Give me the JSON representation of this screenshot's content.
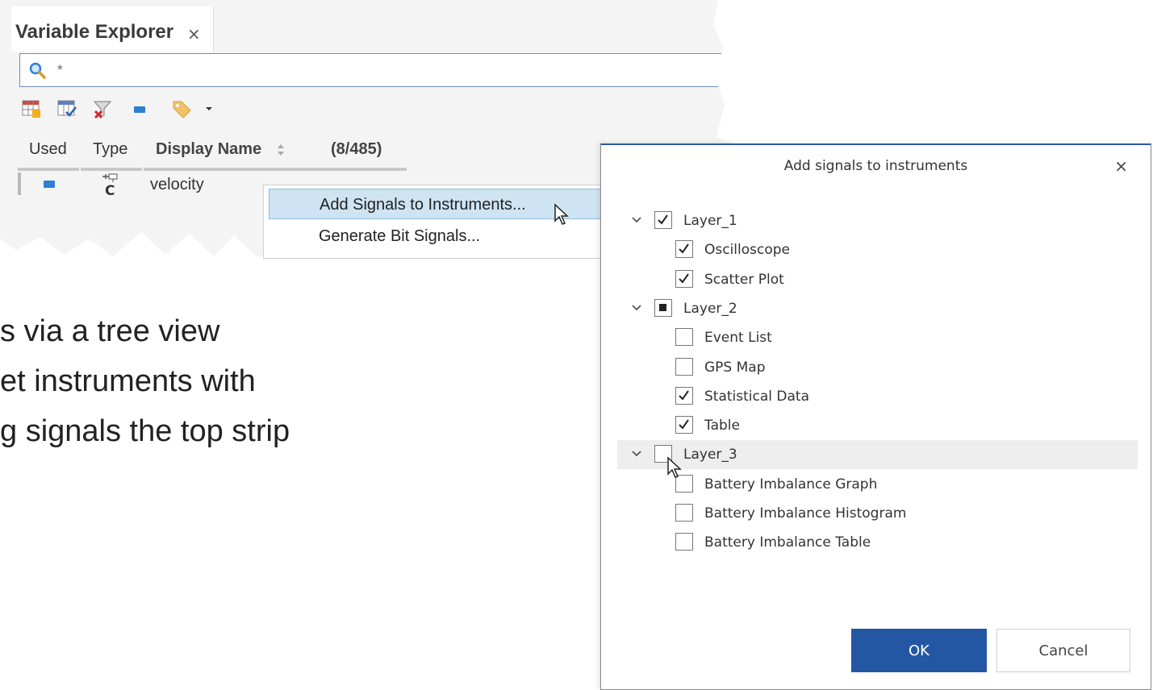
{
  "explorer": {
    "tab_title": "Variable Explorer",
    "tab_close": "×",
    "search_value": "*",
    "columns": {
      "used": "Used",
      "type": "Type",
      "display_name": "Display Name",
      "count": "(8/485)"
    },
    "row": {
      "name": "velocity",
      "type_glyph": "C"
    },
    "toolbar_icons": [
      "table-add-icon",
      "table-check-icon",
      "filter-clear-icon",
      "signal-icon",
      "tag-icon",
      "dropdown-arrow-icon"
    ]
  },
  "context_menu": {
    "items": [
      {
        "label": "Add Signals to Instruments..."
      },
      {
        "label": "Generate Bit Signals..."
      }
    ]
  },
  "background_text": {
    "line1": "s via a tree view",
    "line2": "et instruments with",
    "line3": "g signals the top strip"
  },
  "dialog": {
    "title": "Add signals to instruments",
    "close": "×",
    "tree": [
      {
        "label": "Layer_1",
        "level": 0,
        "state": "checked"
      },
      {
        "label": "Oscilloscope",
        "level": 1,
        "state": "checked"
      },
      {
        "label": "Scatter Plot",
        "level": 1,
        "state": "checked"
      },
      {
        "label": "Layer_2",
        "level": 0,
        "state": "indeterminate"
      },
      {
        "label": "Event List",
        "level": 1,
        "state": "unchecked"
      },
      {
        "label": "GPS Map",
        "level": 1,
        "state": "unchecked"
      },
      {
        "label": "Statistical Data",
        "level": 1,
        "state": "checked"
      },
      {
        "label": "Table",
        "level": 1,
        "state": "checked"
      },
      {
        "label": "Layer_3",
        "level": 0,
        "state": "unchecked"
      },
      {
        "label": "Battery Imbalance Graph",
        "level": 1,
        "state": "unchecked"
      },
      {
        "label": "Battery Imbalance Histogram",
        "level": 1,
        "state": "unchecked"
      },
      {
        "label": "Battery Imbalance Table",
        "level": 1,
        "state": "unchecked"
      }
    ],
    "ok_label": "OK",
    "cancel_label": "Cancel"
  },
  "colors": {
    "accent": "#2457a3",
    "menu_highlight": "#cfe4f3",
    "panel_bg": "#f4f4f4"
  }
}
